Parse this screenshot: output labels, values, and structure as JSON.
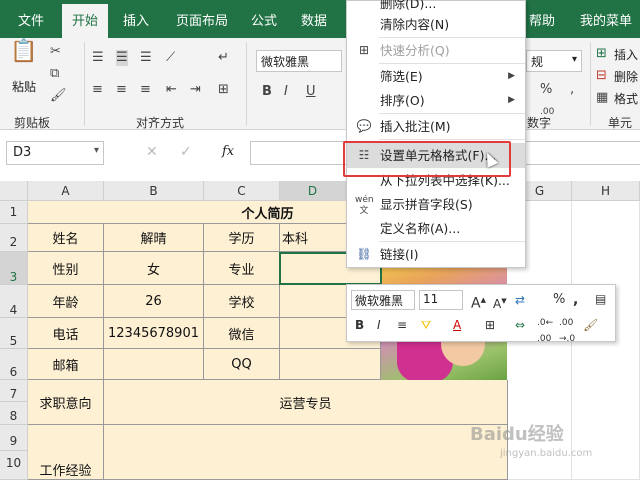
{
  "tabs": [
    "文件",
    "开始",
    "插入",
    "页面布局",
    "公式",
    "数据",
    "帮助",
    "我的菜单"
  ],
  "active_tab_index": 1,
  "ribbon": {
    "clipboard_label": "剪贴板",
    "paste_label": "粘贴",
    "alignment_label": "对齐方式",
    "number_label": "数字",
    "cells_label": "单元格",
    "font_name": "微软雅黑",
    "number_format": "规",
    "insert_label": "插入",
    "delete_label": "删除",
    "format_label": "格式"
  },
  "formula_bar": {
    "name_box": "D3",
    "fx": "fx"
  },
  "columns": [
    "A",
    "B",
    "C",
    "D",
    "G",
    "H"
  ],
  "rows": [
    "1",
    "2",
    "3",
    "4",
    "5",
    "6",
    "7",
    "8",
    "9",
    "10"
  ],
  "sheet": {
    "title": "个人简历",
    "r2": [
      "姓名",
      "解晴",
      "学历",
      "本科"
    ],
    "r3": [
      "性别",
      "女",
      "专业"
    ],
    "r4": [
      "年龄",
      "26",
      "学校"
    ],
    "r5": [
      "电话",
      "12345678901",
      "微信"
    ],
    "r6": [
      "邮箱",
      "",
      "QQ"
    ],
    "r7": [
      "求职意向",
      "运营专员"
    ],
    "r8": [
      "工作经验"
    ]
  },
  "context_menu": {
    "items": [
      {
        "label": "删除(D)...",
        "disabled": false,
        "submenu": false
      },
      {
        "label": "清除内容(N)",
        "disabled": false,
        "submenu": false
      },
      {
        "label": "快速分析(Q)",
        "disabled": true,
        "submenu": false
      },
      {
        "label": "筛选(E)",
        "disabled": false,
        "submenu": true
      },
      {
        "label": "排序(O)",
        "disabled": false,
        "submenu": true
      },
      {
        "label": "插入批注(M)",
        "disabled": false,
        "submenu": false
      },
      {
        "label": "设置单元格格式(F)...",
        "disabled": false,
        "submenu": false,
        "highlighted": true
      },
      {
        "label": "从下拉列表中选择(K)...",
        "disabled": false,
        "submenu": false
      },
      {
        "label": "显示拼音字段(S)",
        "disabled": false,
        "submenu": false
      },
      {
        "label": "定义名称(A)...",
        "disabled": false,
        "submenu": false
      },
      {
        "label": "链接(I)",
        "disabled": false,
        "submenu": false
      }
    ]
  },
  "mini_toolbar": {
    "font_name": "微软雅黑",
    "font_size": "11"
  },
  "watermark": {
    "line1": "Baidu经验",
    "line2": "jingyan.baidu.com"
  }
}
